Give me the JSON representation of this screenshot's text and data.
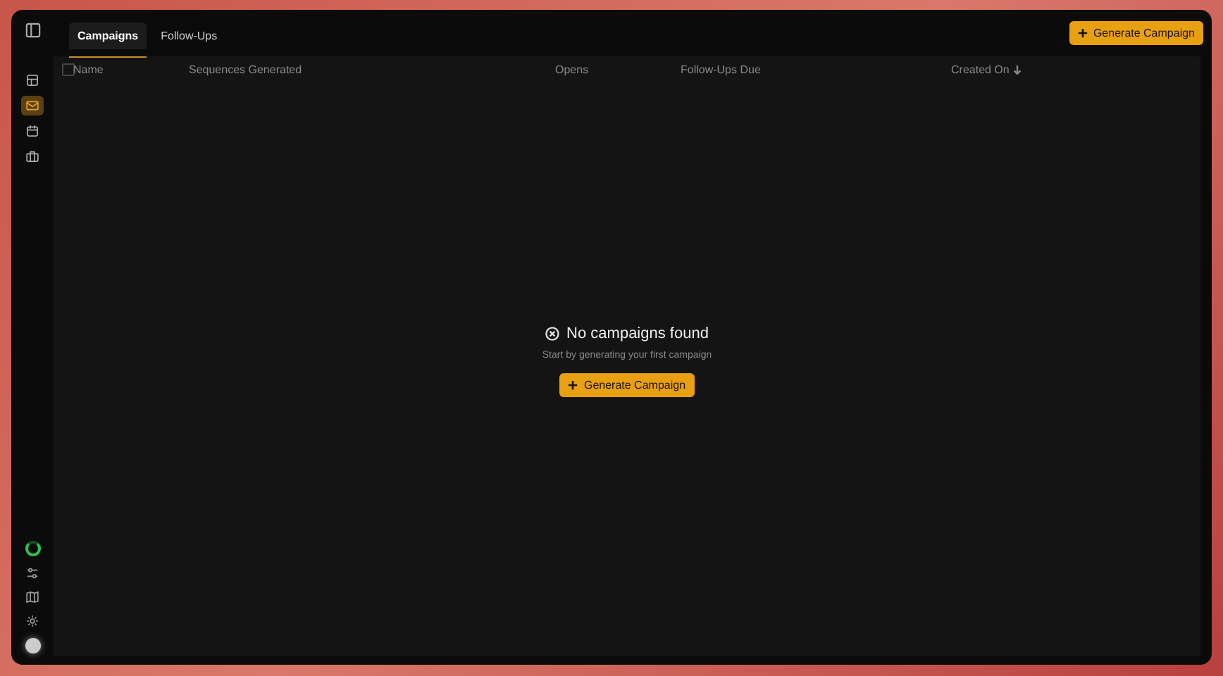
{
  "sidebar": {
    "top_items": [
      {
        "kind": "layout",
        "selected": false
      },
      {
        "kind": "mail",
        "selected": true
      },
      {
        "kind": "calendar",
        "selected": false
      },
      {
        "kind": "briefcase",
        "selected": false
      }
    ],
    "bottom_items": [
      {
        "kind": "ring"
      },
      {
        "kind": "sliders"
      },
      {
        "kind": "map"
      },
      {
        "kind": "gear"
      },
      {
        "kind": "avatar"
      }
    ]
  },
  "tabs": [
    {
      "label": "Campaigns",
      "selected": true
    },
    {
      "label": "Follow-Ups",
      "selected": false
    }
  ],
  "header_button": {
    "label": "Generate Campaign"
  },
  "table": {
    "select_all_checked": false,
    "columns": [
      {
        "label": "Name",
        "sorted": false
      },
      {
        "label": "Sequences Generated",
        "sorted": false
      },
      {
        "label": "Opens",
        "sorted": false
      },
      {
        "label": "Follow-Ups Due",
        "sorted": false
      },
      {
        "label": "Created On",
        "sorted": true
      }
    ]
  },
  "empty_state": {
    "title": "No campaigns found",
    "subtitle": "Start by generating your first campaign",
    "button": "Generate Campaign"
  }
}
